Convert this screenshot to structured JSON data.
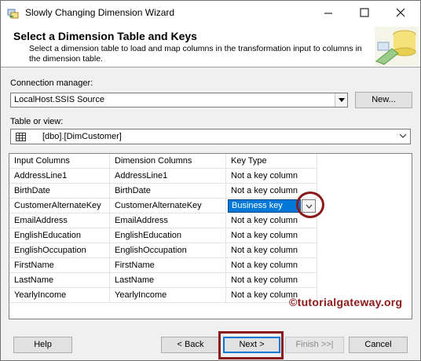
{
  "window": {
    "title": "Slowly Changing Dimension Wizard",
    "min_glyph": "minimize-icon",
    "max_glyph": "maximize-icon",
    "close_glyph": "close-icon"
  },
  "header": {
    "title": "Select a Dimension Table and Keys",
    "description": "Select a dimension table to load and map columns in the transformation input to columns in the dimension table."
  },
  "connection": {
    "label": "Connection manager:",
    "value": "LocalHost.SSIS Source",
    "new_button": "New..."
  },
  "table": {
    "label": "Table or view:",
    "value": "[dbo].[DimCustomer]"
  },
  "grid": {
    "headers": [
      "Input Columns",
      "Dimension Columns",
      "Key Type"
    ],
    "rows": [
      {
        "input": "AddressLine1",
        "dimension": "AddressLine1",
        "key": "Not a key column"
      },
      {
        "input": "BirthDate",
        "dimension": "BirthDate",
        "key": "Not a key column"
      },
      {
        "input": "CustomerAlternateKey",
        "dimension": "CustomerAlternateKey",
        "key": "Business key"
      },
      {
        "input": "EmailAddress",
        "dimension": "EmailAddress",
        "key": "Not a key column"
      },
      {
        "input": "EnglishEducation",
        "dimension": "EnglishEducation",
        "key": "Not a key column"
      },
      {
        "input": "EnglishOccupation",
        "dimension": "EnglishOccupation",
        "key": "Not a key column"
      },
      {
        "input": "FirstName",
        "dimension": "FirstName",
        "key": "Not a key column"
      },
      {
        "input": "LastName",
        "dimension": "LastName",
        "key": "Not a key column"
      },
      {
        "input": "YearlyIncome",
        "dimension": "YearlyIncome",
        "key": "Not a key column"
      }
    ],
    "selected_row": 2
  },
  "watermark": "©tutorialgateway.org",
  "buttons": {
    "help": "Help",
    "back": "< Back",
    "next": "Next >",
    "finish": "Finish >>|",
    "cancel": "Cancel"
  },
  "colors": {
    "selection": "#0078d7",
    "annotation": "#8b1a1a"
  }
}
